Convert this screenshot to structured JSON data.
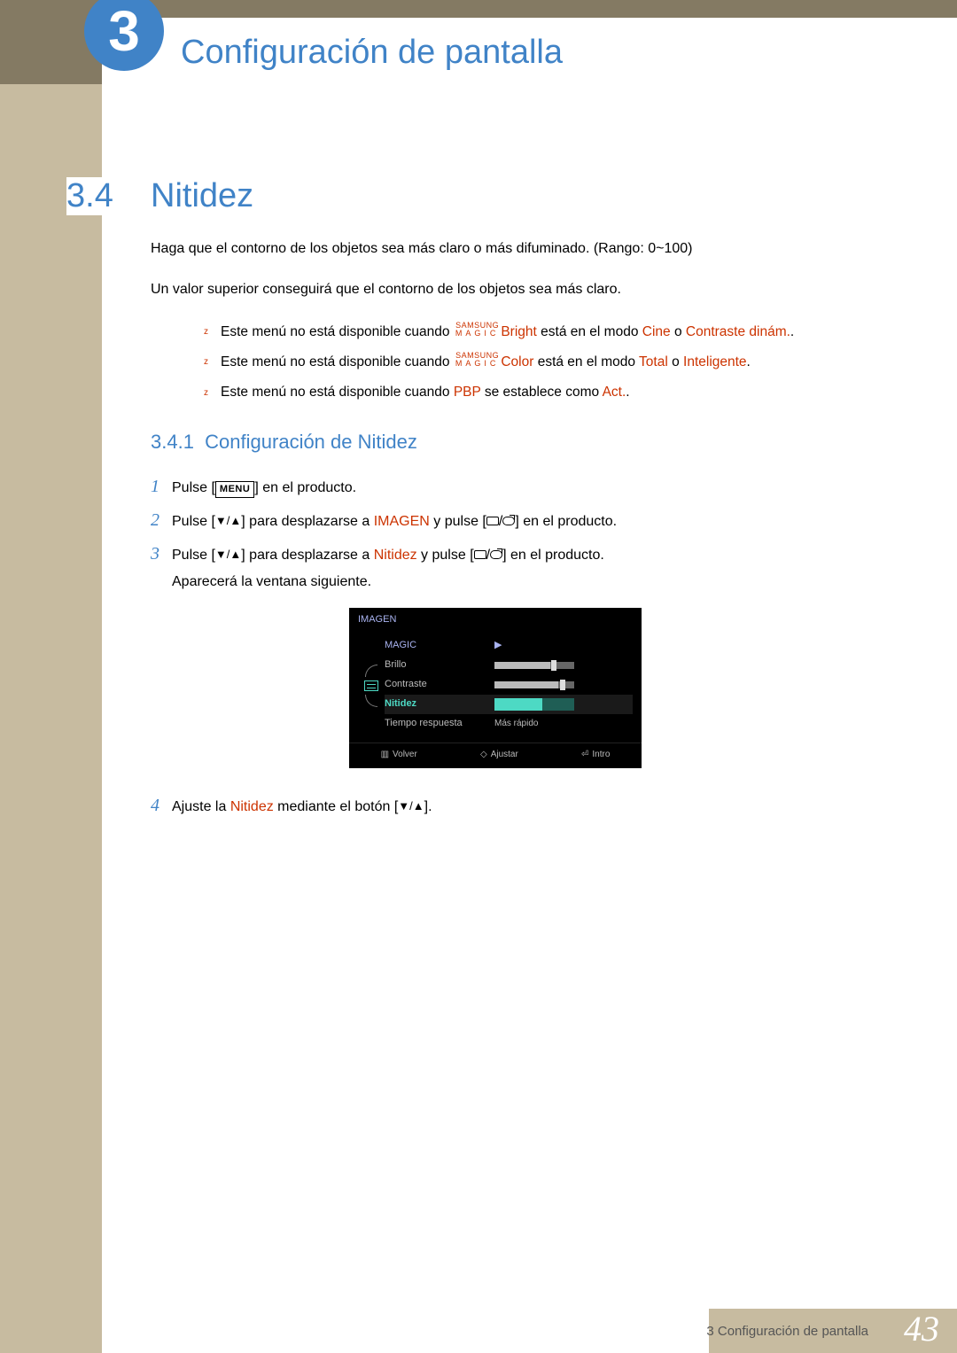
{
  "header": {
    "chapter_num": "3",
    "title": "Configuración de pantalla"
  },
  "section": {
    "num": "3.4",
    "title": "Nitidez"
  },
  "intro": {
    "p1": "Haga que el contorno de los objetos sea más claro o más difuminado. (Rango: 0~100)",
    "p2": "Un valor superior conseguirá que el contorno de los objetos sea más claro."
  },
  "notes": {
    "n1_a": "Este menú no está disponible cuando ",
    "n1_bright": "Bright",
    "n1_b": " está en el modo ",
    "n1_cine": "Cine",
    "n1_c": " o ",
    "n1_contraste": "Contraste dinám.",
    "n1_d": ".",
    "n2_a": "Este menú no está disponible cuando ",
    "n2_color": "Color",
    "n2_b": " está en el modo ",
    "n2_total": "Total",
    "n2_c": " o ",
    "n2_intel": "Inteligente",
    "n2_d": ".",
    "n3_a": "Este menú no está disponible cuando ",
    "n3_pbp": "PBP",
    "n3_b": " se establece como ",
    "n3_act": "Act.",
    "n3_c": "."
  },
  "magic": {
    "top": "SAMSUNG",
    "bot": "MAGIC"
  },
  "subsection": {
    "num": "3.4.1",
    "title": "Configuración de Nitidez"
  },
  "steps": {
    "s1_a": "Pulse [",
    "s1_menu": "MENU",
    "s1_b": "] en el producto.",
    "s2_a": "Pulse [",
    "s2_b": "] para desplazarse a ",
    "s2_imagen": "IMAGEN",
    "s2_c": " y pulse [",
    "s2_d": "] en el producto.",
    "s3_a": "Pulse [",
    "s3_b": "] para desplazarse a ",
    "s3_nitidez": "Nitidez",
    "s3_c": " y pulse [",
    "s3_d": "] en el producto.",
    "s3_sub": "Aparecerá la ventana siguiente.",
    "s4_a": "Ajuste la ",
    "s4_nitidez": "Nitidez",
    "s4_b": " mediante el botón [",
    "s4_c": "]."
  },
  "osd": {
    "title": "IMAGEN",
    "r1": "MAGIC",
    "r2": "Brillo",
    "r3": "Contraste",
    "r4": "Nitidez",
    "r5": "Tiempo respuesta",
    "r5_val": "Más rápido",
    "f1": "Volver",
    "f2": "Ajustar",
    "f3": "Intro"
  },
  "footer": {
    "text": "3 Configuración de pantalla",
    "page": "43"
  }
}
